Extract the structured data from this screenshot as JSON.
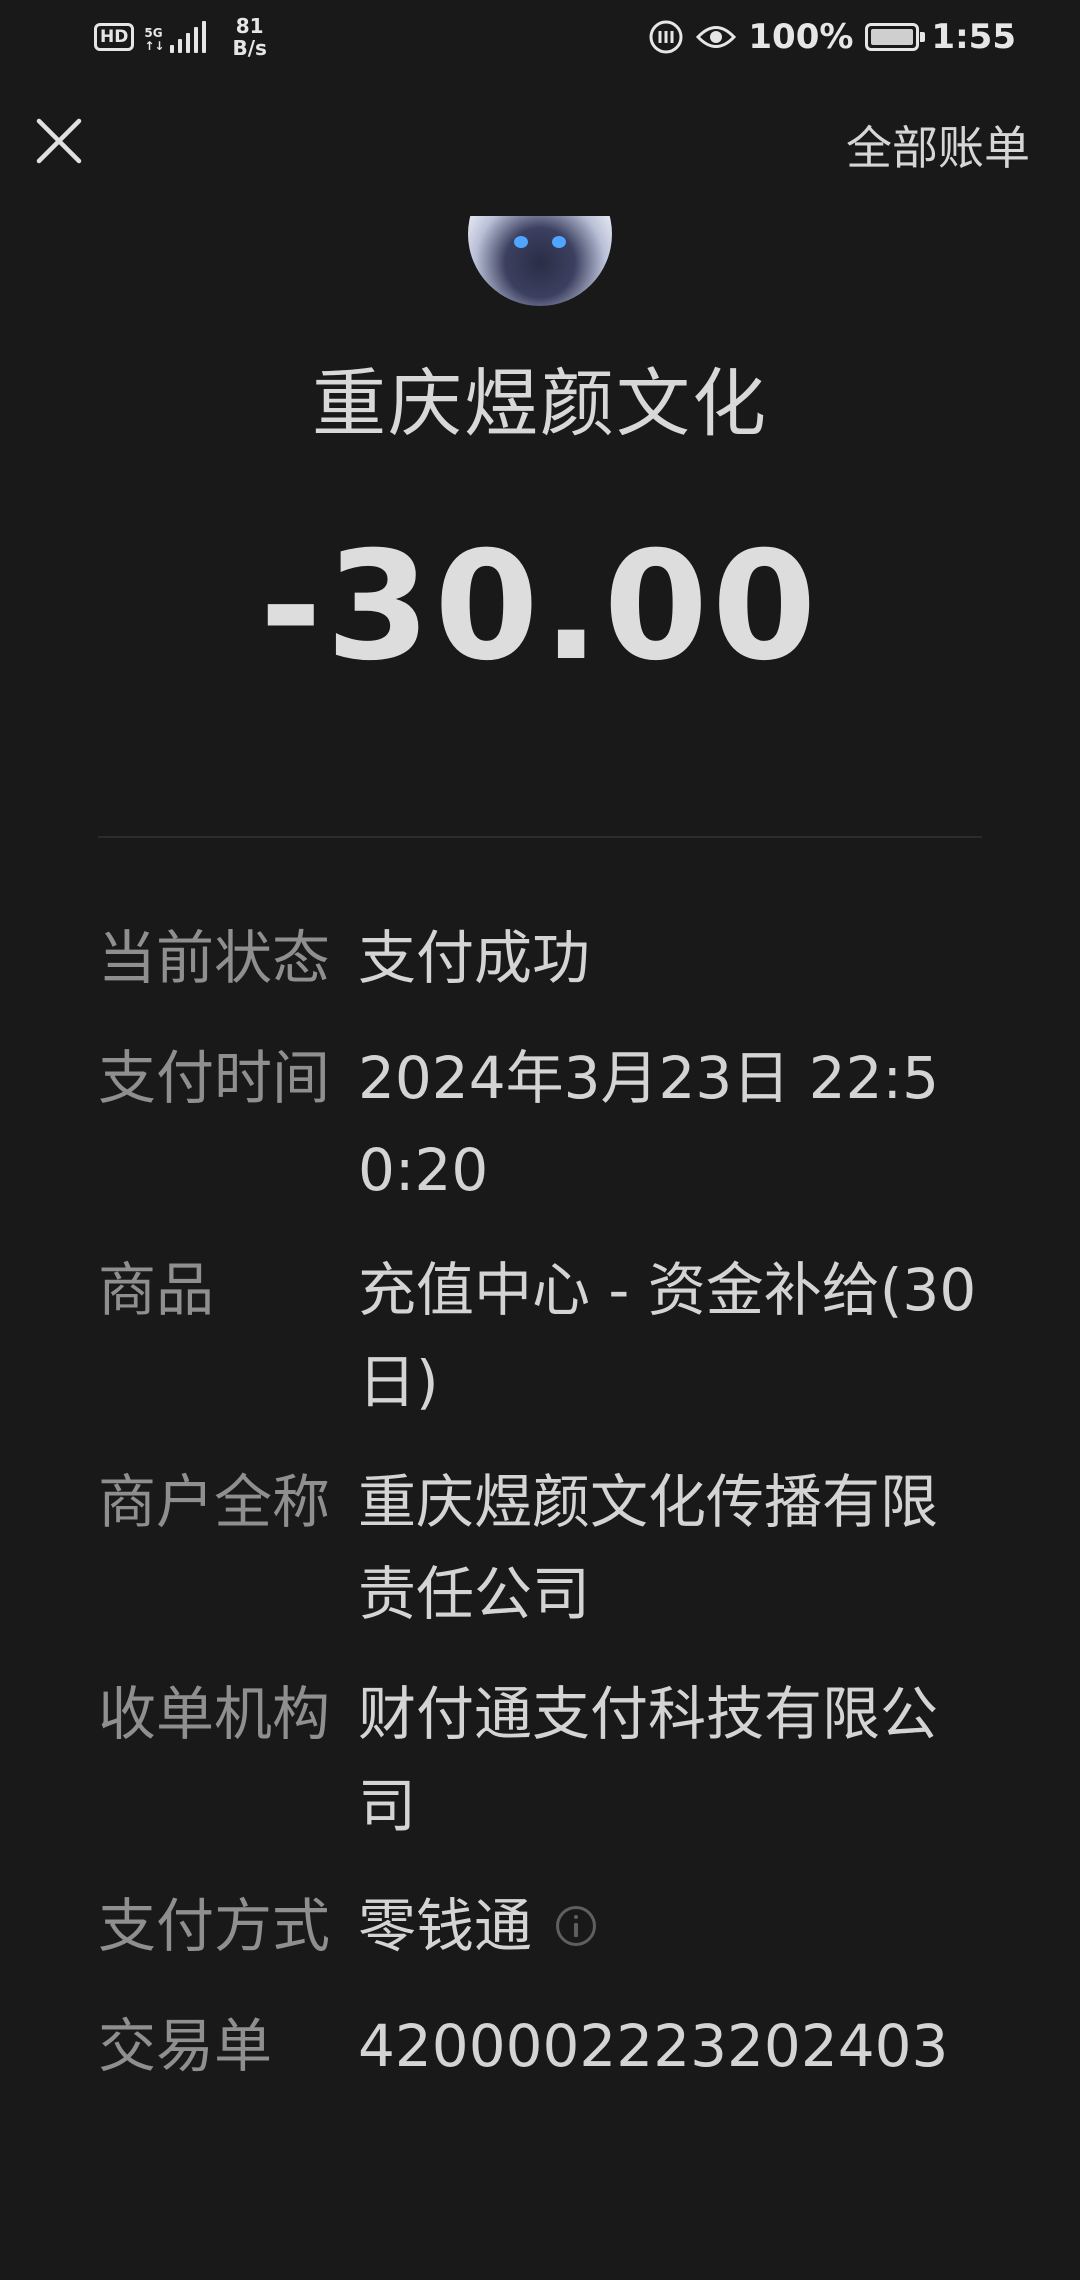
{
  "status_bar": {
    "hd": "HD",
    "network": "5G",
    "speed_value": "81",
    "speed_unit": "B/s",
    "battery": "100%",
    "time": "1:55"
  },
  "nav": {
    "close_icon": "close-icon",
    "all_bills_label": "全部账单"
  },
  "header": {
    "merchant_name": "重庆煜颜文化",
    "amount": "-30.00"
  },
  "details": [
    {
      "label": "当前状态",
      "value": "支付成功"
    },
    {
      "label": "支付时间",
      "value": "2024年3月23日 22:50:20"
    },
    {
      "label": "商品",
      "value": "充值中心 - 资金补给(30日)"
    },
    {
      "label": "商户全称",
      "value": "重庆煜颜文化传播有限责任公司"
    },
    {
      "label": "收单机构",
      "value": "财付通支付科技有限公司"
    },
    {
      "label": "支付方式",
      "value": "零钱通"
    },
    {
      "label": "交易单",
      "value": "4200002223202403"
    }
  ],
  "colors": {
    "background": "#191919",
    "label": "#8f8f8f",
    "value": "#d4d4d4"
  }
}
